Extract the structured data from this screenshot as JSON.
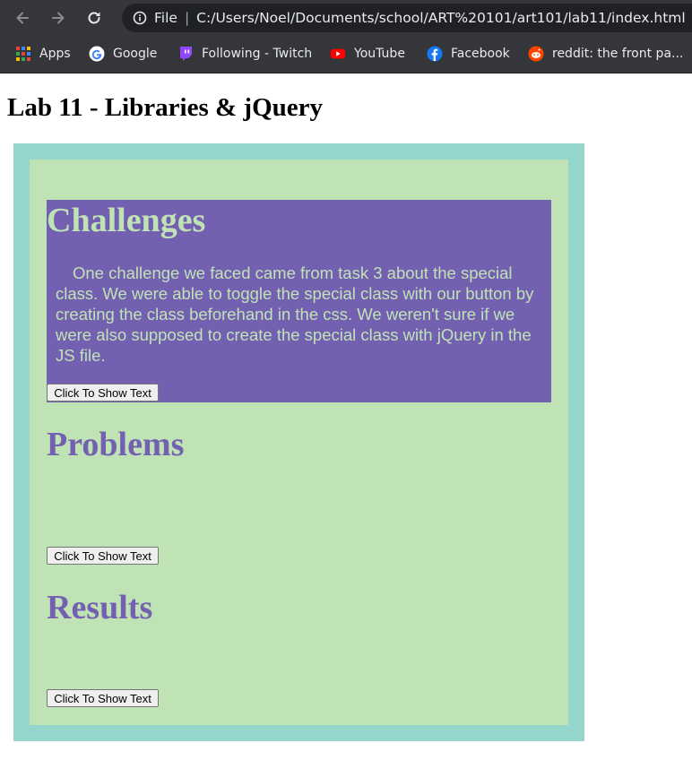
{
  "browser": {
    "address_bar": {
      "scheme_label": "File",
      "separator": "|",
      "url": "C:/Users/Noel/Documents/school/ART%20101/art101/lab11/index.html"
    },
    "bookmarks": [
      {
        "label": "Apps",
        "icon": "apps-grid-icon"
      },
      {
        "label": "Google",
        "icon": "google-icon"
      },
      {
        "label": "Following - Twitch",
        "icon": "twitch-icon"
      },
      {
        "label": "YouTube",
        "icon": "youtube-icon"
      },
      {
        "label": "Facebook",
        "icon": "facebook-icon"
      },
      {
        "label": "reddit: the front pa...",
        "icon": "reddit-icon"
      }
    ]
  },
  "page": {
    "title": "Lab 11 - Libraries & jQuery",
    "sections": [
      {
        "heading": "Challenges",
        "text": "One challenge we faced came from task 3 about the special class. We were able to toggle the special class with our button by creating the class beforehand in the css. We weren't sure if we were also supposed to create the special class with jQuery in the JS file.",
        "button_label": "Click To Show Text"
      },
      {
        "heading": "Problems",
        "button_label": "Click To Show Text"
      },
      {
        "heading": "Results",
        "button_label": "Click To Show Text"
      }
    ]
  },
  "colors": {
    "outer_frame": "#94d6cc",
    "inner_panel": "#c0e3b6",
    "accent_purple": "#7460b0",
    "browser_chrome": "#35363a"
  }
}
